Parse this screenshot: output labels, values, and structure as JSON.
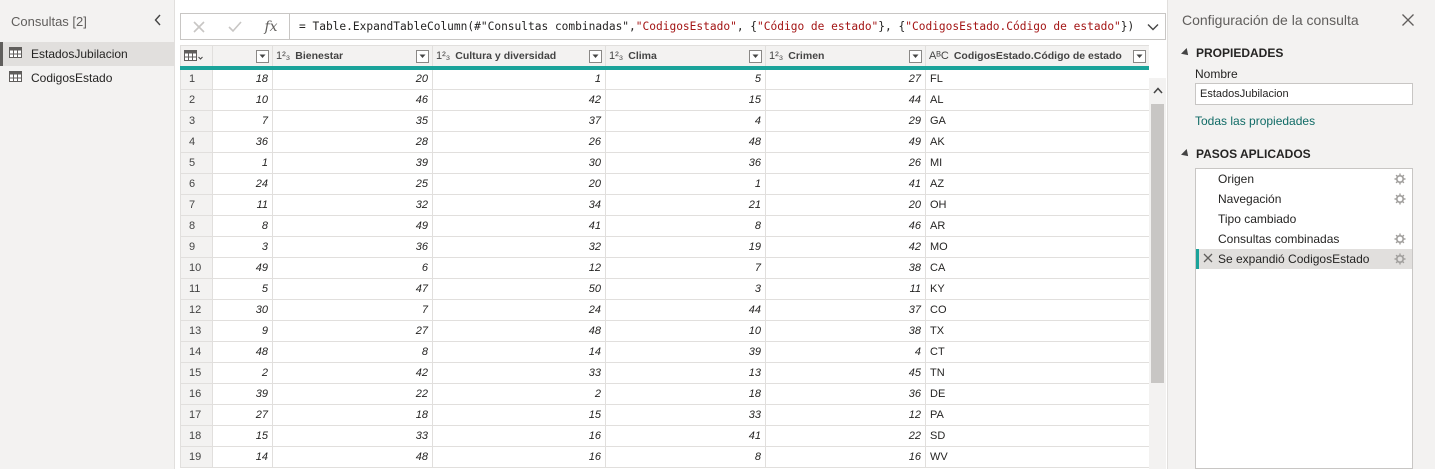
{
  "queries": {
    "header": "Consultas [2]",
    "items": [
      {
        "label": "EstadosJubilacion",
        "selected": true
      },
      {
        "label": "CodigosEstado",
        "selected": false
      }
    ]
  },
  "formula_bar": {
    "fx": "fx",
    "formula_parts": [
      {
        "text": "= Table.ExpandTableColumn(#\"Consultas combinadas\", ",
        "kind": "code"
      },
      {
        "text": "\"CodigosEstado\"",
        "kind": "str"
      },
      {
        "text": ", {",
        "kind": "code"
      },
      {
        "text": "\"Código de estado\"",
        "kind": "str"
      },
      {
        "text": "}, {",
        "kind": "code"
      },
      {
        "text": "\"CodigosEstado.Código de estado\"",
        "kind": "str"
      },
      {
        "text": "})",
        "kind": "code"
      }
    ]
  },
  "grid": {
    "columns": [
      {
        "type": "1²₃",
        "name": "Bienestar"
      },
      {
        "type": "1²₃",
        "name": "Cultura y diversidad"
      },
      {
        "type": "1²₃",
        "name": "Clima"
      },
      {
        "type": "1²₃",
        "name": "Crimen"
      },
      {
        "type": "AᴮC",
        "name": "CodigosEstado.Código de estado"
      }
    ],
    "rows": [
      [
        "1",
        "18",
        "20",
        "1",
        "5",
        "27",
        "FL"
      ],
      [
        "2",
        "10",
        "46",
        "42",
        "15",
        "44",
        "AL"
      ],
      [
        "3",
        "7",
        "35",
        "37",
        "4",
        "29",
        "GA"
      ],
      [
        "4",
        "36",
        "28",
        "26",
        "48",
        "49",
        "AK"
      ],
      [
        "5",
        "1",
        "39",
        "30",
        "36",
        "26",
        "MI"
      ],
      [
        "6",
        "24",
        "25",
        "20",
        "1",
        "41",
        "AZ"
      ],
      [
        "7",
        "11",
        "32",
        "34",
        "21",
        "20",
        "OH"
      ],
      [
        "8",
        "8",
        "49",
        "41",
        "8",
        "46",
        "AR"
      ],
      [
        "9",
        "3",
        "36",
        "32",
        "19",
        "42",
        "MO"
      ],
      [
        "10",
        "49",
        "6",
        "12",
        "7",
        "38",
        "CA"
      ],
      [
        "11",
        "5",
        "47",
        "50",
        "3",
        "11",
        "KY"
      ],
      [
        "12",
        "30",
        "7",
        "24",
        "44",
        "37",
        "CO"
      ],
      [
        "13",
        "9",
        "27",
        "48",
        "10",
        "38",
        "TX"
      ],
      [
        "14",
        "48",
        "8",
        "14",
        "39",
        "4",
        "CT"
      ],
      [
        "15",
        "2",
        "42",
        "33",
        "13",
        "45",
        "TN"
      ],
      [
        "16",
        "39",
        "22",
        "2",
        "18",
        "36",
        "DE"
      ],
      [
        "17",
        "27",
        "18",
        "15",
        "33",
        "12",
        "PA"
      ],
      [
        "18",
        "15",
        "33",
        "16",
        "41",
        "22",
        "SD"
      ],
      [
        "19",
        "14",
        "48",
        "16",
        "8",
        "16",
        "WV"
      ]
    ]
  },
  "settings": {
    "title": "Configuración de la consulta",
    "properties_header": "PROPIEDADES",
    "name_label": "Nombre",
    "name_value": "EstadosJubilacion",
    "all_properties": "Todas las propiedades",
    "steps_header": "PASOS APLICADOS",
    "steps": [
      {
        "label": "Origen",
        "gear": true,
        "selected": false
      },
      {
        "label": "Navegación",
        "gear": true,
        "selected": false
      },
      {
        "label": "Tipo cambiado",
        "gear": false,
        "selected": false
      },
      {
        "label": "Consultas combinadas",
        "gear": true,
        "selected": false
      },
      {
        "label": "Se expandió CodigosEstado",
        "gear": true,
        "selected": true
      }
    ]
  },
  "colors": {
    "accent": "#1aa39a",
    "string": "#a31515",
    "link": "#106b66"
  }
}
